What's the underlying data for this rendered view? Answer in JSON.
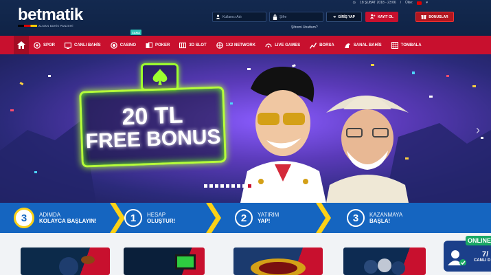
{
  "header": {
    "logo": "betmatik",
    "logo_tagline": "ALMAN BAHİS PANZERİ",
    "datetime": "18 ŞUBAT 2018 - 23:06",
    "separator": "/",
    "country_label": "Ülke:",
    "username_placeholder": "Kullanıcı Adı",
    "password_placeholder": "Şifre",
    "login_label": "GİRİŞ YAP",
    "register_label": "KAYIT OL",
    "bonus_label": "BONUSLAR",
    "forgot_label": "Şifremi Unuttum?"
  },
  "nav": {
    "live_tag": "CANLI",
    "items": [
      {
        "label": "SPOR",
        "icon": "soccer-icon"
      },
      {
        "label": "CANLI BAHİS",
        "icon": "tv-icon"
      },
      {
        "label": "CASINO",
        "icon": "chip-icon"
      },
      {
        "label": "POKER",
        "icon": "cards-icon"
      },
      {
        "label": "3D SLOT",
        "icon": "slot-icon"
      },
      {
        "label": "1X2 NETWORK",
        "icon": "network-icon"
      },
      {
        "label": "LIVE GAMES",
        "icon": "live-icon"
      },
      {
        "label": "BORSA",
        "icon": "chart-icon"
      },
      {
        "label": "SANAL BAHİS",
        "icon": "horse-icon"
      },
      {
        "label": "TOMBALA",
        "icon": "bingo-icon"
      }
    ]
  },
  "banner": {
    "line1": "20 TL",
    "line2": "FREE BONUS",
    "slide_count": 9,
    "active_slide": 9
  },
  "steps": [
    {
      "number": "3",
      "line1": "ADIMDA",
      "line2": "KOLAYCA BAŞLAYIN!"
    },
    {
      "number": "1",
      "line1": "HESAP",
      "line2": "OLUŞTUR!"
    },
    {
      "number": "2",
      "line1": "YATIRIM",
      "line2": "YAP!"
    },
    {
      "number": "3",
      "line1": "KAZANMAYA",
      "line2": "BAŞLA!"
    }
  ],
  "chat": {
    "status": "ONLINE",
    "count": "7/",
    "label": "CANLI D"
  },
  "colors": {
    "primary_red": "#c8102e",
    "header_navy": "#13294f",
    "steps_blue": "#1565c0",
    "neon_green": "#b6ff3a",
    "accent_yellow": "#fcd116"
  }
}
